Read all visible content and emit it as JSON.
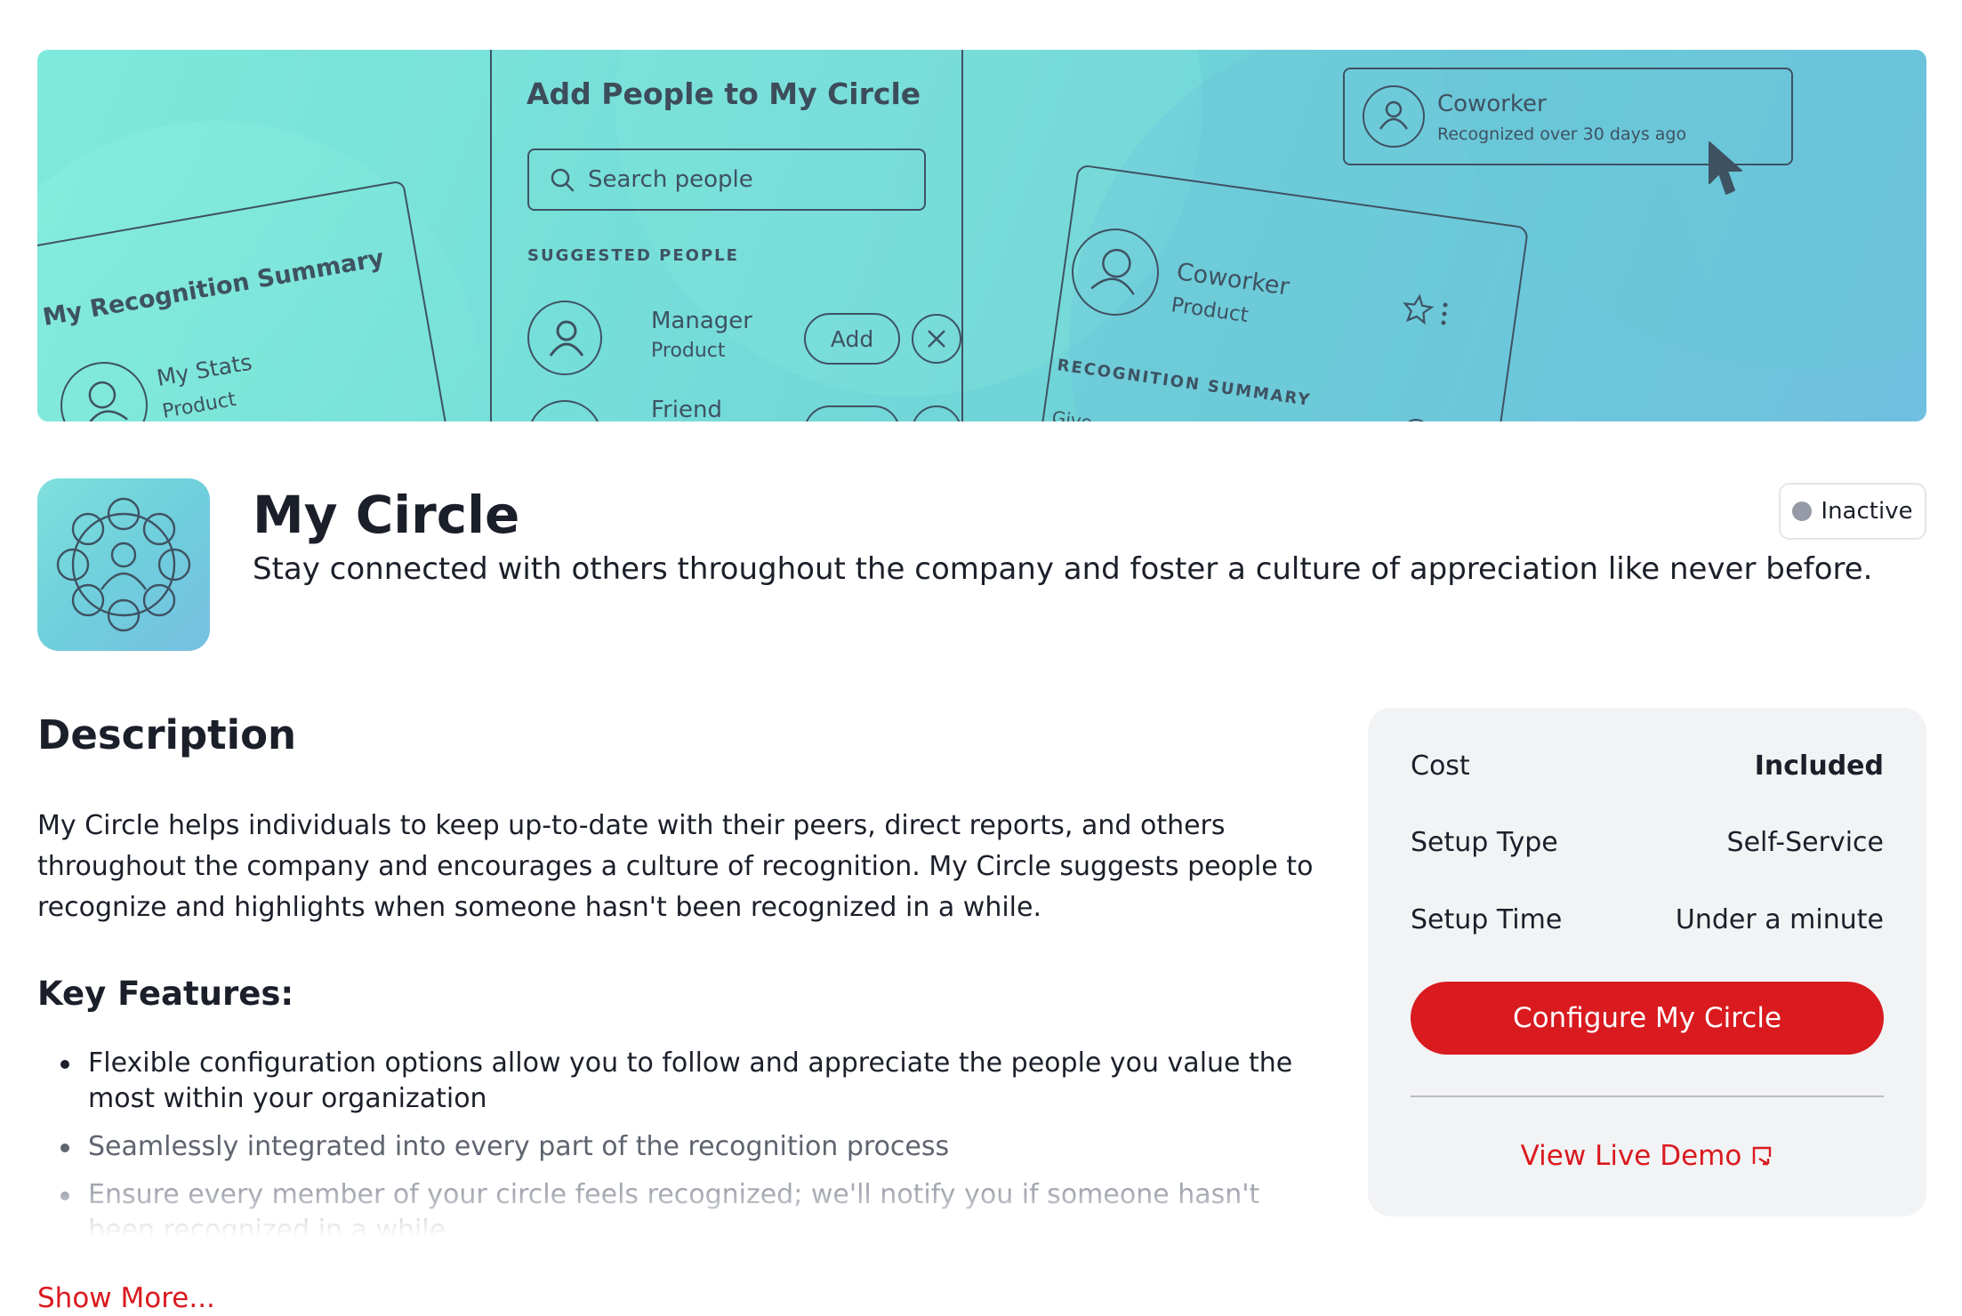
{
  "banner": {
    "summary_card": {
      "title": "My Recognition Summary",
      "stats_name": "My Stats",
      "stats_sub": "Product"
    },
    "add_people": {
      "title": "Add People to My Circle",
      "search_placeholder": "Search people",
      "suggested_label": "SUGGESTED PEOPLE",
      "people": [
        {
          "name": "Manager",
          "sub": "Product",
          "add_label": "Add"
        },
        {
          "name": "Friend"
        }
      ]
    },
    "coworker_card": {
      "name": "Coworker",
      "sub": "Recognized over 30 days ago"
    },
    "profile_card": {
      "name": "Coworker",
      "sub": "Product",
      "section_label": "RECOGNITION SUMMARY",
      "partial_text": "Give"
    }
  },
  "app": {
    "title": "My Circle",
    "subtitle": "Stay connected with others throughout the company and foster a culture of appreciation like never before.",
    "status": "Inactive",
    "status_color": "#959aa6",
    "icon": "circle-people-icon"
  },
  "description": {
    "heading": "Description",
    "body": "My Circle helps individuals to keep up-to-date with their peers, direct reports, and others throughout the company and encourages a culture of recognition. My Circle suggests people to recognize and highlights when someone hasn't been recognized in a while.",
    "features_heading": "Key Features:",
    "features": [
      "Flexible configuration options allow you to follow and appreciate the people you value the most within your organization",
      "Seamlessly integrated into every part of the recognition process",
      "Ensure every member of your circle feels recognized; we'll notify you if someone hasn't been recognized in a while"
    ],
    "show_more": "Show More..."
  },
  "details": {
    "rows": [
      {
        "label": "Cost",
        "value": "Included"
      },
      {
        "label": "Setup Type",
        "value": "Self-Service"
      },
      {
        "label": "Setup Time",
        "value": "Under a minute"
      }
    ],
    "configure_label": "Configure My Circle",
    "demo_label": "View Live Demo"
  },
  "colors": {
    "accent": "#d91a1f",
    "text": "#1b1f2a",
    "card_bg": "#f2f3f5"
  }
}
